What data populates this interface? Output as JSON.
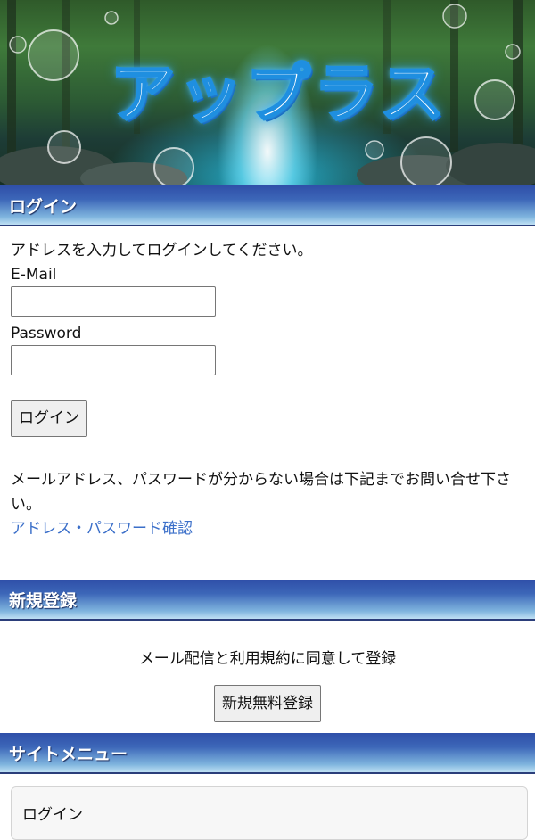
{
  "banner": {
    "logo_text": "アップラス"
  },
  "login": {
    "header": "ログイン",
    "intro": "アドレスを入力してログインしてください。",
    "email_label": "E-Mail",
    "email_value": "",
    "password_label": "Password",
    "password_value": "",
    "button": "ログイン",
    "notice": "メールアドレス、パスワードが分からない場合は下記までお問い合せ下さい。",
    "link": "アドレス・パスワード確認"
  },
  "register": {
    "header": "新規登録",
    "terms": "メール配信と利用規約に同意して登録",
    "button": "新規無料登録"
  },
  "site_menu": {
    "header": "サイトメニュー",
    "items": [
      {
        "label": "ログイン"
      }
    ]
  },
  "colors": {
    "header_top": "#2f4fa8",
    "header_bottom": "#bfe0f4",
    "link": "#3b6fc9"
  }
}
